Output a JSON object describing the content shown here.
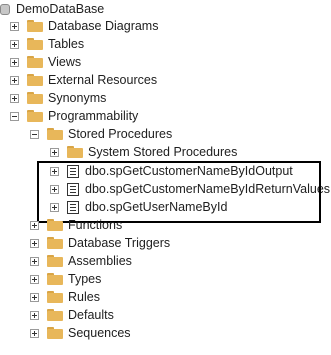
{
  "tree": {
    "root": "DemoDataBase",
    "level1": [
      "Database Diagrams",
      "Tables",
      "Views",
      "External Resources",
      "Synonyms",
      "Programmability"
    ],
    "stored_procedures": "Stored Procedures",
    "system_stored_procedures": "System Stored Procedures",
    "procedures": [
      "dbo.spGetCustomerNameByIdOutput",
      "dbo.spGetCustomerNameByIdReturnValues",
      "dbo.spGetUserNameById"
    ],
    "level2": [
      "Functions",
      "Database Triggers",
      "Assemblies",
      "Types",
      "Rules",
      "Defaults",
      "Sequences"
    ]
  },
  "icons": {
    "expander_collapsed": "plus-box-icon",
    "expander_expanded": "minus-box-icon",
    "folder": "folder-icon",
    "procedure": "stored-procedure-icon"
  },
  "colors": {
    "folder": "#e8b75a",
    "highlight_border": "#000000"
  }
}
